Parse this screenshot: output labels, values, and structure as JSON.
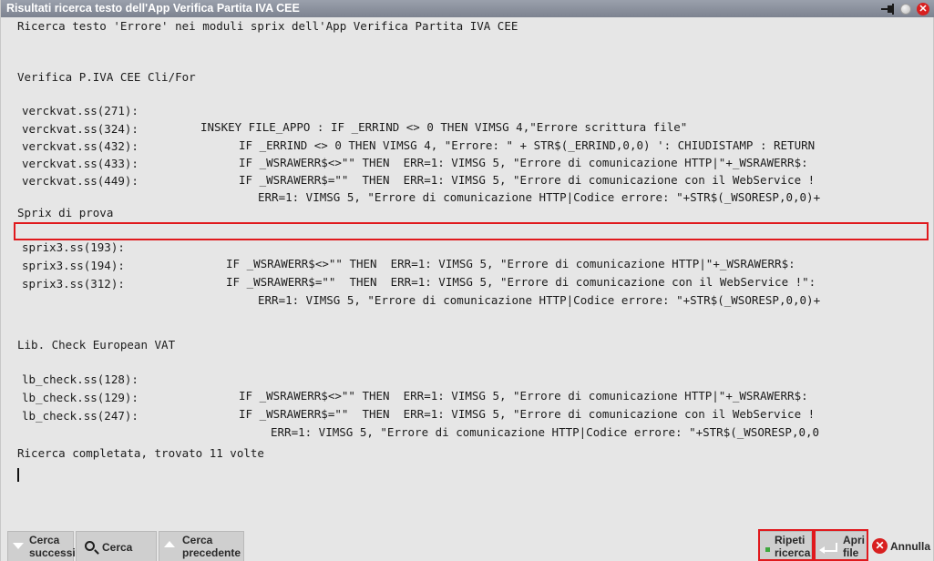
{
  "window": {
    "title": "Risultati ricerca testo dell'App Verifica Partita IVA CEE",
    "icons": [
      "pin-icon",
      "minimize-dot-icon",
      "close-icon"
    ]
  },
  "header_line": "Ricerca testo 'Errore' nei moduli sprix dell'App Verifica Partita IVA CEE",
  "groups": [
    {
      "title": "Verifica P.IVA CEE Cli/For",
      "results": [
        {
          "file": "verckvat.ss(271):",
          "code": "INSKEY FILE_APPO : IF _ERRIND <> 0 THEN VIMSG 4,\"Errore scrittura file\""
        },
        {
          "file": "verckvat.ss(324):",
          "code": "IF _ERRIND <> 0 THEN VIMSG 4, \"Errore: \" + STR$(_ERRIND,0,0) ': CHIUDISTAMP : RETURN"
        },
        {
          "file": "verckvat.ss(432):",
          "code": "IF _WSRAWERR$<>\"\" THEN  ERR=1: VIMSG 5, \"Errore di comunicazione HTTP|\"+_WSRAWERR$:"
        },
        {
          "file": "verckvat.ss(433):",
          "code": "IF _WSRAWERR$=\"\"  THEN  ERR=1: VIMSG 5, \"Errore di comunicazione con il WebService !"
        },
        {
          "file": "verckvat.ss(449):",
          "code": "ERR=1: VIMSG 5, \"Errore di comunicazione HTTP|Codice errore: \"+STR$(_WSORESP,0,0)+"
        }
      ]
    },
    {
      "title": "Sprix di prova",
      "results": [
        {
          "file": "sprix3.ss(193):",
          "code": "IF _WSRAWERR$<>\"\" THEN  ERR=1: VIMSG 5, \"Errore di comunicazione HTTP|\"+_WSRAWERR$:"
        },
        {
          "file": "sprix3.ss(194):",
          "code": "IF _WSRAWERR$=\"\"  THEN  ERR=1: VIMSG 5, \"Errore di comunicazione con il WebService !\":"
        },
        {
          "file": "sprix3.ss(312):",
          "code": "ERR=1: VIMSG 5, \"Errore di comunicazione HTTP|Codice errore: \"+STR$(_WSORESP,0,0)+"
        }
      ]
    },
    {
      "title": "Lib. Check European VAT",
      "results": [
        {
          "file": "lb_check.ss(128):",
          "code": "IF _WSRAWERR$<>\"\" THEN  ERR=1: VIMSG 5, \"Errore di comunicazione HTTP|\"+_WSRAWERR$:"
        },
        {
          "file": "lb_check.ss(129):",
          "code": "IF _WSRAWERR$=\"\"  THEN  ERR=1: VIMSG 5, \"Errore di comunicazione con il WebService !"
        },
        {
          "file": "lb_check.ss(247):",
          "code": "ERR=1: VIMSG 5, \"Errore di comunicazione HTTP|Codice errore: \"+STR$(_WSORESP,0,0"
        }
      ]
    }
  ],
  "summary_line": "Ricerca completata, trovato 11 volte",
  "highlighted_result": "sprix3.ss(193):",
  "buttons": {
    "cerca_successivo": [
      "Cerca",
      "successivo"
    ],
    "cerca": "Cerca",
    "cerca_precedente": [
      "Cerca",
      "precedente"
    ],
    "ripeti_ricerca": [
      "Ripeti",
      "ricerca"
    ],
    "apri_file": [
      "Apri",
      "file"
    ],
    "annulla": "Annulla"
  },
  "colors": {
    "titlebar": "#8a909c",
    "background": "#e6e6e6",
    "highlight_border": "#e0191d",
    "close": "#d82020"
  }
}
